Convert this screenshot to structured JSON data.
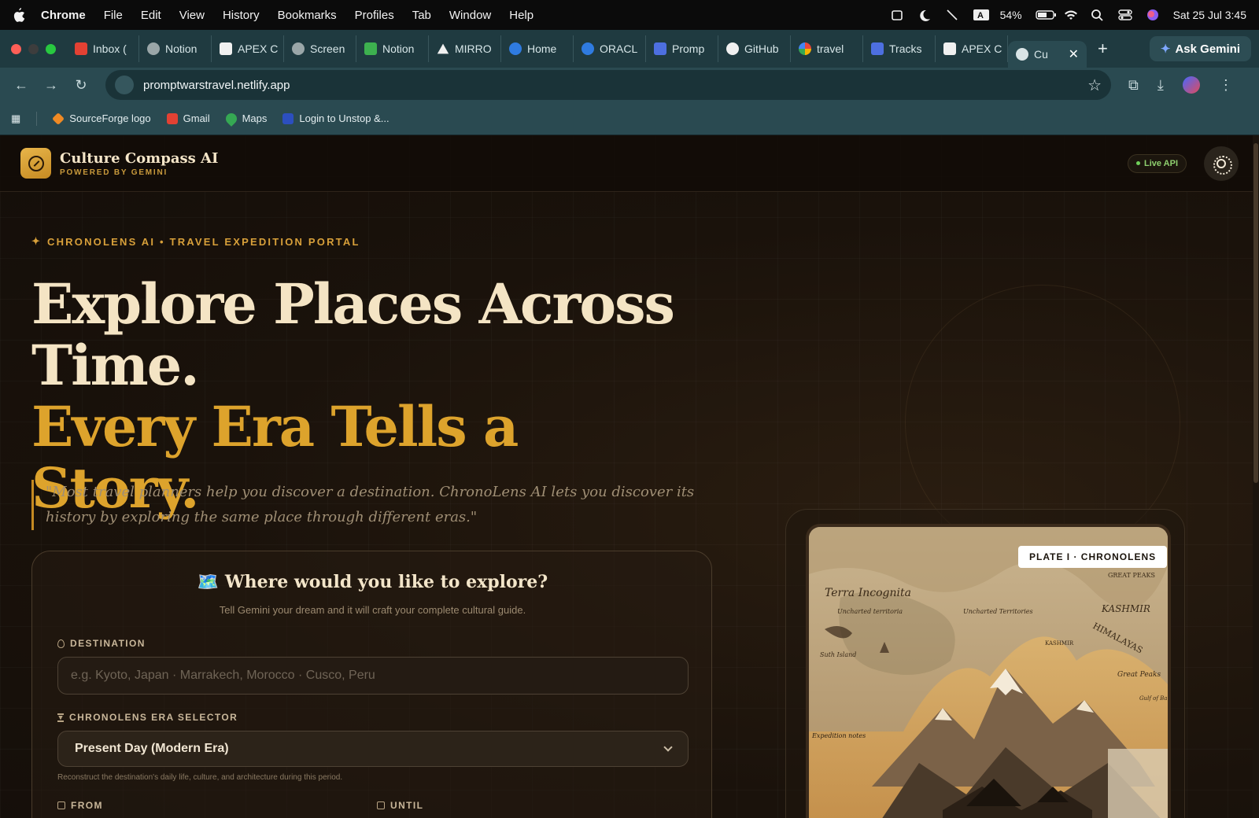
{
  "menubar": {
    "app": "Chrome",
    "items": [
      "File",
      "Edit",
      "View",
      "History",
      "Bookmarks",
      "Profiles",
      "Tab",
      "Window",
      "Help"
    ],
    "battery": "54%",
    "datetime": "Sat 25 Jul  3:45"
  },
  "tabs": [
    {
      "label": "Inbox (",
      "color": "#e34133"
    },
    {
      "label": "Notion",
      "color": "#9aa6a8"
    },
    {
      "label": "APEX C",
      "color": "#f0f0f0"
    },
    {
      "label": "Screen",
      "color": "#9aa6a8"
    },
    {
      "label": "Notion",
      "color": "#3db04f"
    },
    {
      "label": "MIRRO",
      "color": "#111111"
    },
    {
      "label": "Home",
      "color": "#2f7be0"
    },
    {
      "label": "ORACL",
      "color": "#2f7be0"
    },
    {
      "label": "Promp",
      "color": "#4d6fe0"
    },
    {
      "label": "GitHub",
      "color": "#f0f0f0"
    },
    {
      "label": "travel",
      "color": "#e9453a"
    },
    {
      "label": "Tracks",
      "color": "#4d6fe0"
    },
    {
      "label": "APEX C",
      "color": "#f0f0f0"
    }
  ],
  "active_tab": {
    "label": "Cu",
    "close": "✕"
  },
  "new_tab": "+",
  "ask_gemini": "Ask Gemini",
  "address": "promptwarstravel.netlify.app",
  "bookmarks": [
    {
      "label": "SourceForge logo",
      "color": "#f08a24"
    },
    {
      "label": "Gmail",
      "color": "#e34133"
    },
    {
      "label": "Maps",
      "color": "#35a853"
    },
    {
      "label": "Login to Unstop &...",
      "color": "#2c4fbf"
    }
  ],
  "app": {
    "brand": "Culture Compass AI",
    "brand_sub": "POWERED BY GEMINI",
    "live_badge": "Live API",
    "kicker": "CHRONOLENS AI • TRAVEL EXPEDITION PORTAL",
    "headline_line1": "Explore Places Across Time.",
    "headline_line2": "Every Era Tells a Story.",
    "quote": "\"Most travel planners help you discover a destination. ChronoLens AI lets you discover its history by exploring the same place through different eras.\"",
    "form": {
      "title": "🗺️ Where would you like to explore?",
      "subtitle": "Tell Gemini your dream and it will craft your complete cultural guide.",
      "destination_label": "DESTINATION",
      "destination_placeholder": "e.g. Kyoto, Japan · Marrakech, Morocco · Cusco, Peru",
      "era_label": "CHRONOLENS ERA SELECTOR",
      "era_value": "Present Day (Modern Era)",
      "era_hint": "Reconstruct the destination's daily life, culture, and architecture during this period.",
      "from_label": "FROM",
      "until_label": "UNTIL"
    },
    "plate_badge": "PLATE I · CHRONOLENS",
    "map_labels": {
      "terra": "Terra Incognita",
      "uncharted1": "Uncharted territoria",
      "uncharted2": "Uncharted Territories",
      "kashmir": "KASHMIR",
      "himalayas": "HIMALAYAS",
      "great_peaks": "GREAT PEAKS",
      "great_peaks2": "Great Peaks",
      "south_island": "Suth Island",
      "kashmir_small": "KASHMIR",
      "bengal": "Gulf of Bangal",
      "notes": "Expedition notes"
    }
  },
  "colors": {
    "accent": "#dda32c",
    "bg": "#1a120b",
    "cream": "#f4e4c4"
  }
}
